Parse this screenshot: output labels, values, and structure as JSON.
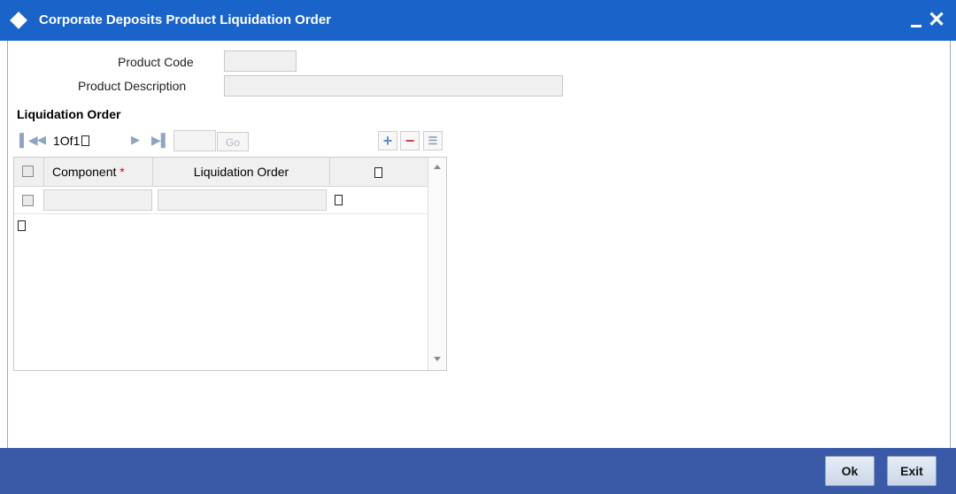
{
  "window": {
    "title": "Corporate Deposits Product Liquidation Order",
    "minimize_icon": "minimize-icon",
    "close_icon": "close-icon"
  },
  "form": {
    "product_code_label": "Product Code",
    "product_code_value": "",
    "product_description_label": "Product Description",
    "product_description_value": ""
  },
  "liquidation_section": {
    "title": "Liquidation Order",
    "pager": {
      "current": "1",
      "of_text": "Of",
      "total": "1",
      "page_input_value": "",
      "go_label": "Go"
    },
    "toolbar_icons": [
      "add-row-icon",
      "delete-row-icon",
      "single-view-icon"
    ],
    "columns": [
      {
        "label": "Component",
        "required": true,
        "required_mark": "*"
      },
      {
        "label": "Liquidation Order",
        "required": false
      }
    ],
    "rows": [
      {
        "component": "",
        "liquidation_order": ""
      }
    ]
  },
  "footer": {
    "ok_label": "Ok",
    "exit_label": "Exit"
  },
  "colors": {
    "titlebar": "#1a63c8",
    "footer": "#3a5aa8",
    "required": "#dd0000"
  }
}
